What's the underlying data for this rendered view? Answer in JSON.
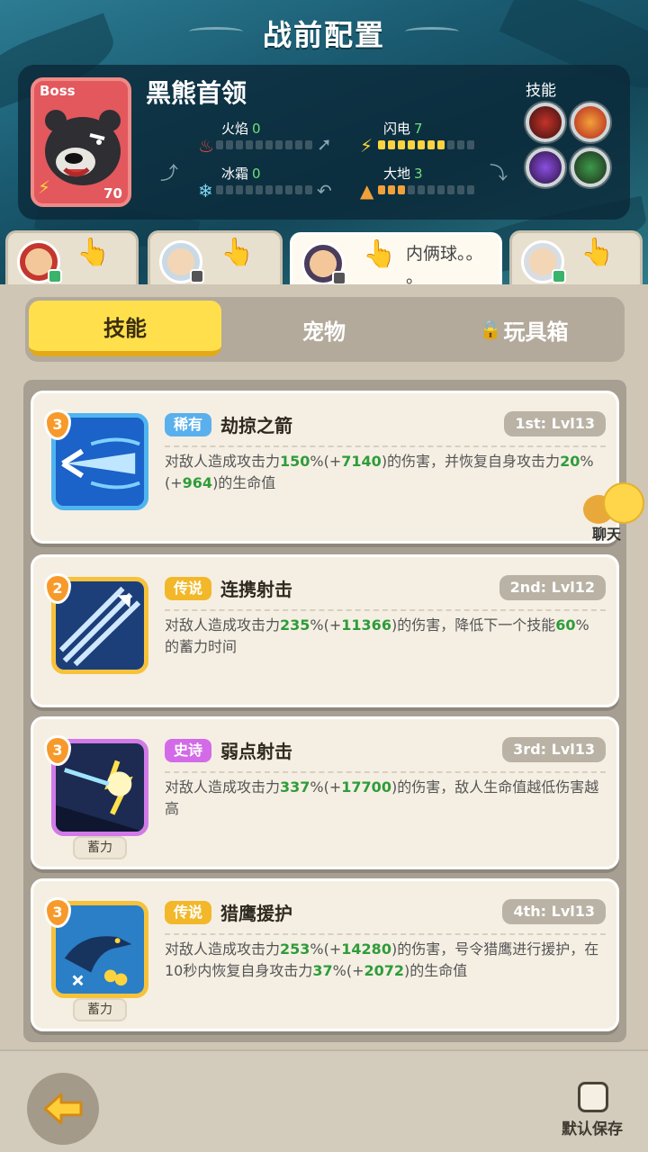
{
  "header": {
    "title": "战前配置"
  },
  "boss": {
    "tag": "Boss",
    "name": "黑熊首领",
    "level": "70",
    "skills_label": "技能",
    "elements": [
      {
        "name": "火焰",
        "value": "0",
        "filled": 0,
        "icon": "fire-icon",
        "color": "#e84a3a"
      },
      {
        "name": "闪电",
        "value": "7",
        "filled": 7,
        "icon": "lightning-icon",
        "color": "#ffd33d"
      },
      {
        "name": "冰霜",
        "value": "0",
        "filled": 0,
        "icon": "frost-icon",
        "color": "#7fd6f3"
      },
      {
        "name": "大地",
        "value": "3",
        "filled": 3,
        "icon": "earth-icon",
        "color": "#f2a03a"
      }
    ]
  },
  "heroes": [
    {
      "id": "hero-1",
      "note": ""
    },
    {
      "id": "hero-2",
      "note": ""
    },
    {
      "id": "hero-3",
      "note": "内俩球。。\n。",
      "active": true
    },
    {
      "id": "hero-4",
      "note": ""
    }
  ],
  "tabs": [
    {
      "label": "技能",
      "active": true
    },
    {
      "label": "宠物",
      "active": false
    },
    {
      "label": "玩具箱",
      "active": false,
      "locked": true
    }
  ],
  "skills": [
    {
      "level": "3",
      "rarity": "稀有",
      "rarity_color": "#5ab0ec",
      "frame_color": "#4fb4f0",
      "name": "劫掠之箭",
      "slot": "1st: Lvl13",
      "desc": [
        "对敌人造成攻击力",
        "150",
        "%(+",
        "7140",
        ")的伤害，并恢复自身攻击力",
        "20",
        "%(+",
        "964",
        ")的生命值"
      ],
      "charge": ""
    },
    {
      "level": "2",
      "rarity": "传说",
      "rarity_color": "#f2b82a",
      "frame_color": "#f7c23a",
      "name": "连携射击",
      "slot": "2nd: Lvl12",
      "desc": [
        "对敌人造成攻击力",
        "235",
        "%(+",
        "11366",
        ")的伤害，降低下一个技能",
        "60",
        "%的蓄力时间"
      ],
      "charge": ""
    },
    {
      "level": "3",
      "rarity": "史诗",
      "rarity_color": "#d36be8",
      "frame_color": "#d17ae8",
      "name": "弱点射击",
      "slot": "3rd: Lvl13",
      "desc": [
        "对敌人造成攻击力",
        "337",
        "%(+",
        "17700",
        ")的伤害，敌人生命值越低伤害越高"
      ],
      "charge": "蓄力"
    },
    {
      "level": "3",
      "rarity": "传说",
      "rarity_color": "#f2b82a",
      "frame_color": "#f7c23a",
      "name": "猎鹰援护",
      "slot": "4th: Lvl13",
      "desc": [
        "对敌人造成攻击力",
        "253",
        "%(+",
        "14280",
        ")的伤害，号令猎鹰进行援护，在10秒内恢复自身攻击力",
        "37",
        "%(+",
        "2072",
        ")的生命值"
      ],
      "charge": "蓄力"
    }
  ],
  "chat": {
    "label": "聊天"
  },
  "footer": {
    "save_label": "默认保存"
  }
}
